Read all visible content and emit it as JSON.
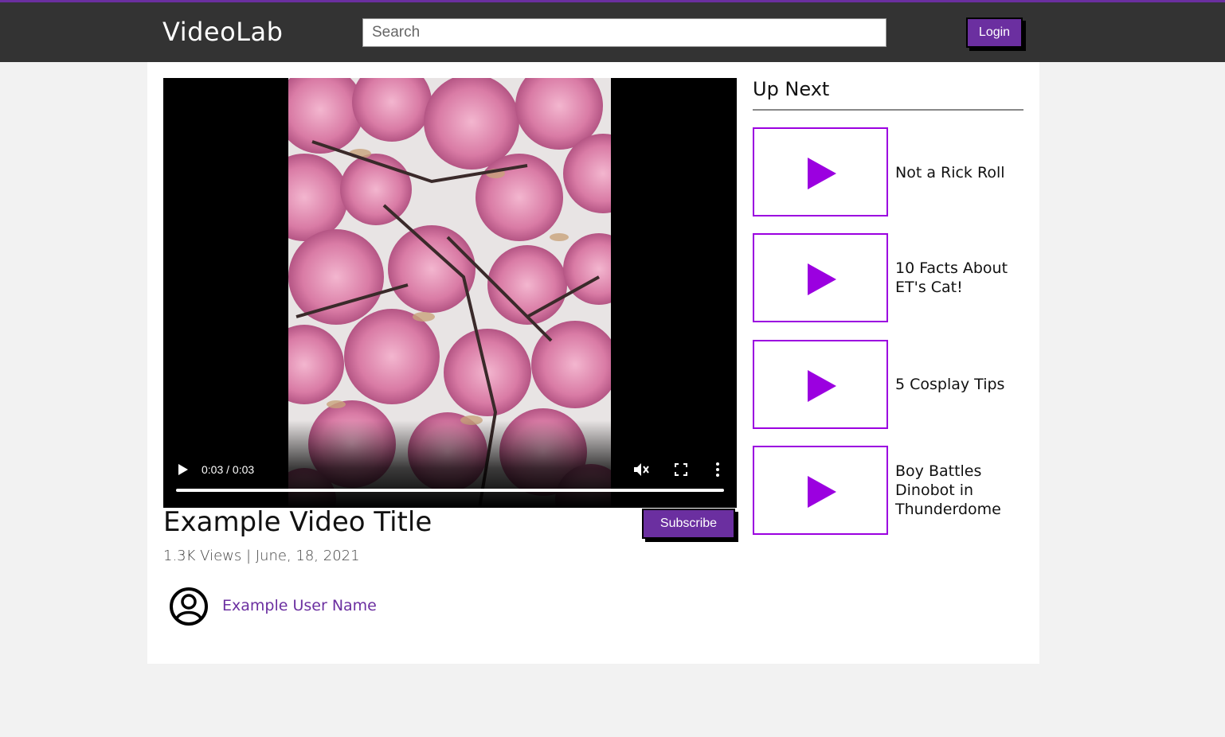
{
  "header": {
    "logo": "VideoLab",
    "search_placeholder": "Search",
    "login_label": "Login"
  },
  "player": {
    "time": "0:03 / 0:03",
    "progress": 1.0
  },
  "video": {
    "title": "Example Video Title",
    "meta": "1.3K Views | June, 18, 2021",
    "subscribe_label": "Subscribe",
    "user_name": "Example User Name"
  },
  "up_next": {
    "heading": "Up Next",
    "items": [
      {
        "label": "Not a Rick Roll"
      },
      {
        "label": "10 Facts About ET's Cat!"
      },
      {
        "label": "5 Cosplay Tips"
      },
      {
        "label": "Boy Battles Dinobot in Thunderdome"
      }
    ]
  },
  "colors": {
    "accent": "#6b2fa0",
    "play_icon": "#9b00e0",
    "header_bg": "#333333"
  },
  "icons": [
    "play-icon",
    "mute-icon",
    "fullscreen-icon",
    "more-options-icon",
    "user-avatar-icon"
  ]
}
